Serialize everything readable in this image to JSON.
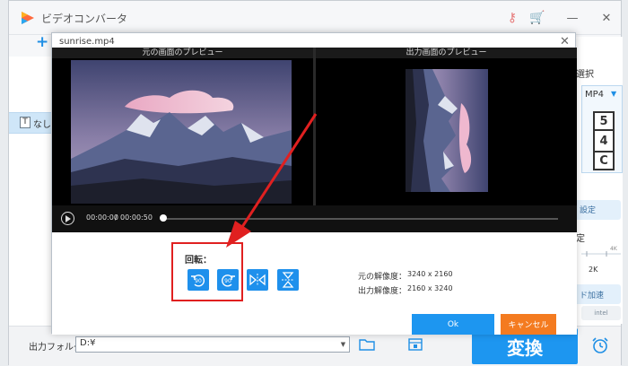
{
  "app": {
    "title": "ビデオコンバータ",
    "add_icon": "plus-icon",
    "left_panel": {
      "subtitle_icon_text": "T",
      "subtitle_value": "なし"
    },
    "right_panel": {
      "format_select_label": "選択",
      "format_value": "MP4",
      "digits": [
        "5",
        "4",
        "C"
      ],
      "settings_label": "設定",
      "resolution_label": "定",
      "res_scale_label": "4K",
      "res_value": "2K",
      "hw_accel_label": "ド加速",
      "intel_label": "intel"
    },
    "bottom": {
      "output_folder_label": "出力フォルダ：",
      "output_folder_value": "D:¥",
      "convert_label": "変換"
    }
  },
  "dialog": {
    "file_name": "sunrise.mp4",
    "preview_original_label": "元の画面のプレビュー",
    "preview_output_label": "出力画面のプレビュー",
    "player": {
      "current_time": "00:00:00",
      "separator": "/",
      "total_time": "00:00:50",
      "progress": 0.0
    },
    "rotation_label": "回転：",
    "rotate_buttons": [
      {
        "icon": "rotate-left-90-icon",
        "text": "90"
      },
      {
        "icon": "rotate-right-90-icon",
        "text": "90"
      },
      {
        "icon": "flip-horizontal-icon",
        "text": ""
      },
      {
        "icon": "flip-vertical-icon",
        "text": ""
      }
    ],
    "source_resolution_label": "元の解像度：",
    "source_resolution_value": "3240 x 2160",
    "output_resolution_label": "出力解像度：",
    "output_resolution_value": "2160 x 3240",
    "ok_label": "Ok",
    "cancel_label": "キャンセル"
  },
  "colors": {
    "accent": "#1d96f0",
    "cancel": "#f47b20",
    "annotation": "#e02020"
  }
}
